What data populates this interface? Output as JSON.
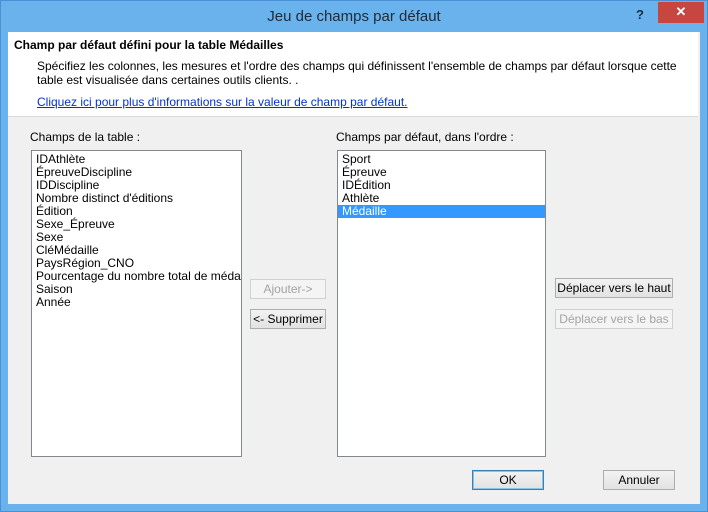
{
  "window": {
    "title": "Jeu de champs par défaut",
    "help_glyph": "?",
    "close_glyph": "✕"
  },
  "header": {
    "title": "Champ par défaut défini pour la table Médailles",
    "description": "Spécifiez les colonnes, les mesures et  l'ordre des champs qui définissent l'ensemble de champs par défaut lorsque cette table est visualisée dans certaines outils clients. .",
    "link": "Cliquez ici pour plus d'informations sur la valeur de champ par défaut."
  },
  "table_fields": {
    "label": "Champs de la table :",
    "items": [
      "IDAthlète",
      "ÉpreuveDiscipline",
      "IDDiscipline",
      "Nombre distinct d'éditions",
      "Édition",
      "Sexe_Épreuve",
      "Sexe",
      "CléMédaille",
      "PaysRégion_CNO",
      "Pourcentage du nombre total de médailles",
      "Saison",
      "Année"
    ]
  },
  "default_fields": {
    "label": "Champs par défaut, dans l'ordre :",
    "items": [
      "Sport",
      "Épreuve",
      "IDÉdition",
      "Athlète",
      "Médaille"
    ],
    "selected_index": 4
  },
  "buttons": {
    "add": "Ajouter->",
    "remove": "<- Supprimer",
    "move_up": "Déplacer vers le haut",
    "move_down": "Déplacer vers le bas",
    "ok": "OK",
    "cancel": "Annuler"
  }
}
